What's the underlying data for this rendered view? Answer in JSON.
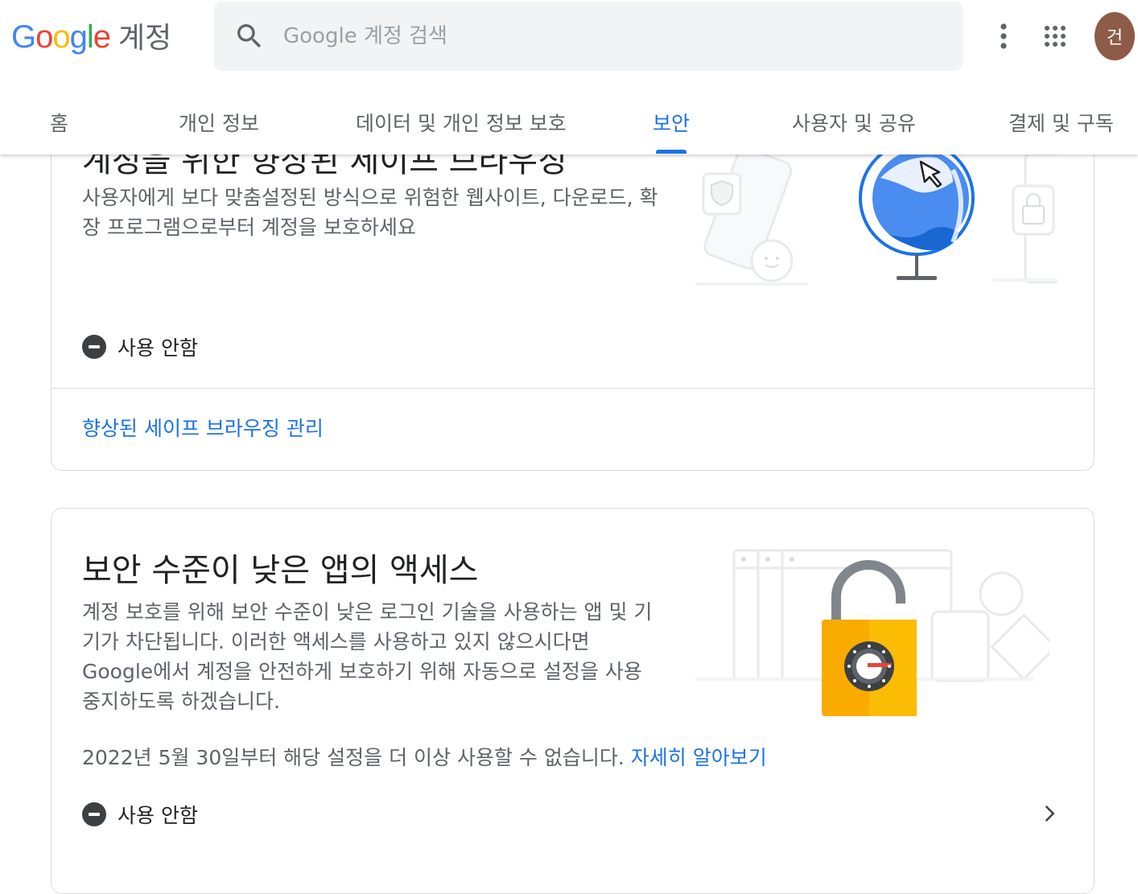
{
  "header": {
    "logo_letters": [
      "G",
      "o",
      "o",
      "g",
      "l",
      "e"
    ],
    "logo_word": "계정",
    "search_placeholder": "Google 계정 검색",
    "avatar_initial": "건"
  },
  "tabs": [
    {
      "label": "홈"
    },
    {
      "label": "개인 정보"
    },
    {
      "label": "데이터 및 개인 정보 보호"
    },
    {
      "label": "보안",
      "active": true
    },
    {
      "label": "사용자 및 공유"
    },
    {
      "label": "결제 및 구독"
    }
  ],
  "safe_browsing_card": {
    "title": "계정을 위한 향상된 세이프 브라우징",
    "description": "사용자에게 보다 맞춤설정된 방식으로 위험한 웹사이트, 다운로드, 확장 프로그램으로부터 계정을 보호하세요",
    "status": "사용 안함",
    "link": "향상된 세이프 브라우징 관리"
  },
  "less_secure_card": {
    "title": "보안 수준이 낮은 앱의 액세스",
    "description": "계정 보호를 위해 보안 수준이 낮은 로그인 기술을 사용하는 앱 및 기기가 차단됩니다. 이러한 액세스를 사용하고 있지 않으시다면 Google에서 계정을 안전하게 보호하기 위해 자동으로 설정을 사용 중지하도록 하겠습니다.",
    "note": "2022년 5월 30일부터 해당 설정을 더 이상 사용할 수 없습니다.",
    "learn_more": "자세히 알아보기",
    "status": "사용 안함"
  },
  "colors": {
    "accent": "#1a73e8",
    "avatar_bg": "#8d5b47",
    "lock": "#f9ab00"
  },
  "icons": [
    "search-icon",
    "more-vert-icon",
    "apps-grid-icon",
    "minus-circle-icon",
    "chevron-right-icon",
    "globe-cursor-icon",
    "open-lock-icon"
  ]
}
